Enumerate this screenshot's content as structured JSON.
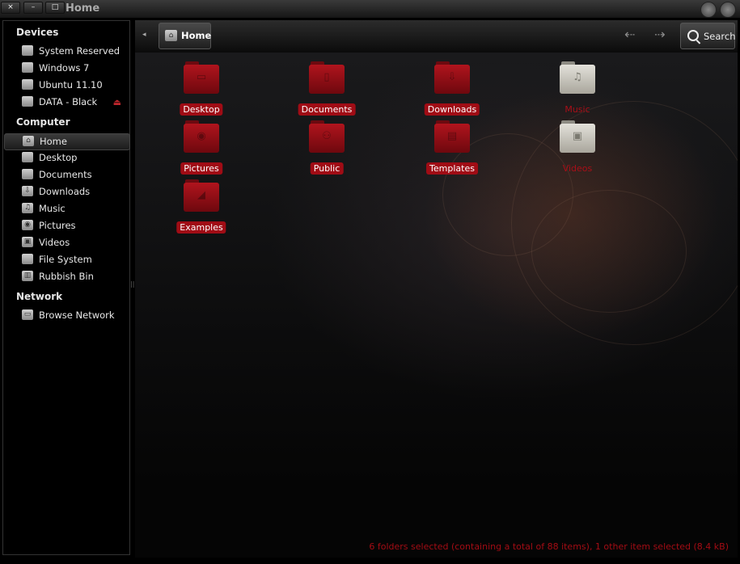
{
  "window": {
    "title": "Home",
    "close_glyph": "×",
    "minimize_glyph": "–",
    "maximize_glyph": "□"
  },
  "sidebar": {
    "devices_header": "Devices",
    "devices": [
      {
        "label": "System Reserved",
        "icon": "drive-icon"
      },
      {
        "label": "Windows 7",
        "icon": "drive-icon"
      },
      {
        "label": "Ubuntu 11.10",
        "icon": "drive-icon"
      },
      {
        "label": "DATA - Black",
        "icon": "drive-icon",
        "eject": "⏏"
      }
    ],
    "computer_header": "Computer",
    "computer": [
      {
        "label": "Home",
        "icon": "home-folder-icon",
        "selected": true
      },
      {
        "label": "Desktop",
        "icon": "desktop-folder-icon"
      },
      {
        "label": "Documents",
        "icon": "documents-folder-icon"
      },
      {
        "label": "Downloads",
        "icon": "downloads-folder-icon"
      },
      {
        "label": "Music",
        "icon": "music-folder-icon"
      },
      {
        "label": "Pictures",
        "icon": "pictures-folder-icon"
      },
      {
        "label": "Videos",
        "icon": "videos-folder-icon"
      },
      {
        "label": "File System",
        "icon": "filesystem-icon"
      },
      {
        "label": "Rubbish Bin",
        "icon": "trash-icon"
      }
    ],
    "network_header": "Network",
    "network": [
      {
        "label": "Browse Network",
        "icon": "network-icon"
      }
    ]
  },
  "toolbar": {
    "breadcrumb_label": "Home",
    "back_glyph": "⇠",
    "forward_glyph": "⇢",
    "search_label": "Search"
  },
  "folders": [
    {
      "label": "Desktop",
      "selected": true,
      "icon": "desktop-folder-icon",
      "emblem": "▭"
    },
    {
      "label": "Documents",
      "selected": true,
      "icon": "documents-folder-icon",
      "emblem": "▯"
    },
    {
      "label": "Downloads",
      "selected": true,
      "icon": "downloads-folder-icon",
      "emblem": "⇩"
    },
    {
      "label": "Music",
      "selected": false,
      "icon": "music-folder-icon",
      "emblem": "♫"
    },
    {
      "label": "Pictures",
      "selected": true,
      "icon": "pictures-folder-icon",
      "emblem": "◉"
    },
    {
      "label": "Public",
      "selected": true,
      "icon": "public-folder-icon",
      "emblem": "⚇"
    },
    {
      "label": "Templates",
      "selected": true,
      "icon": "templates-folder-icon",
      "emblem": "▤"
    },
    {
      "label": "Videos",
      "selected": false,
      "icon": "videos-folder-icon",
      "emblem": "▣"
    },
    {
      "label": "Examples",
      "selected": true,
      "icon": "examples-folder-icon",
      "emblem": "◢"
    }
  ],
  "status": "6 folders selected (containing a total of 88 items), 1 other item selected (8.4 kB)",
  "colors": {
    "accent_red": "#a00c15",
    "background": "#000000"
  }
}
